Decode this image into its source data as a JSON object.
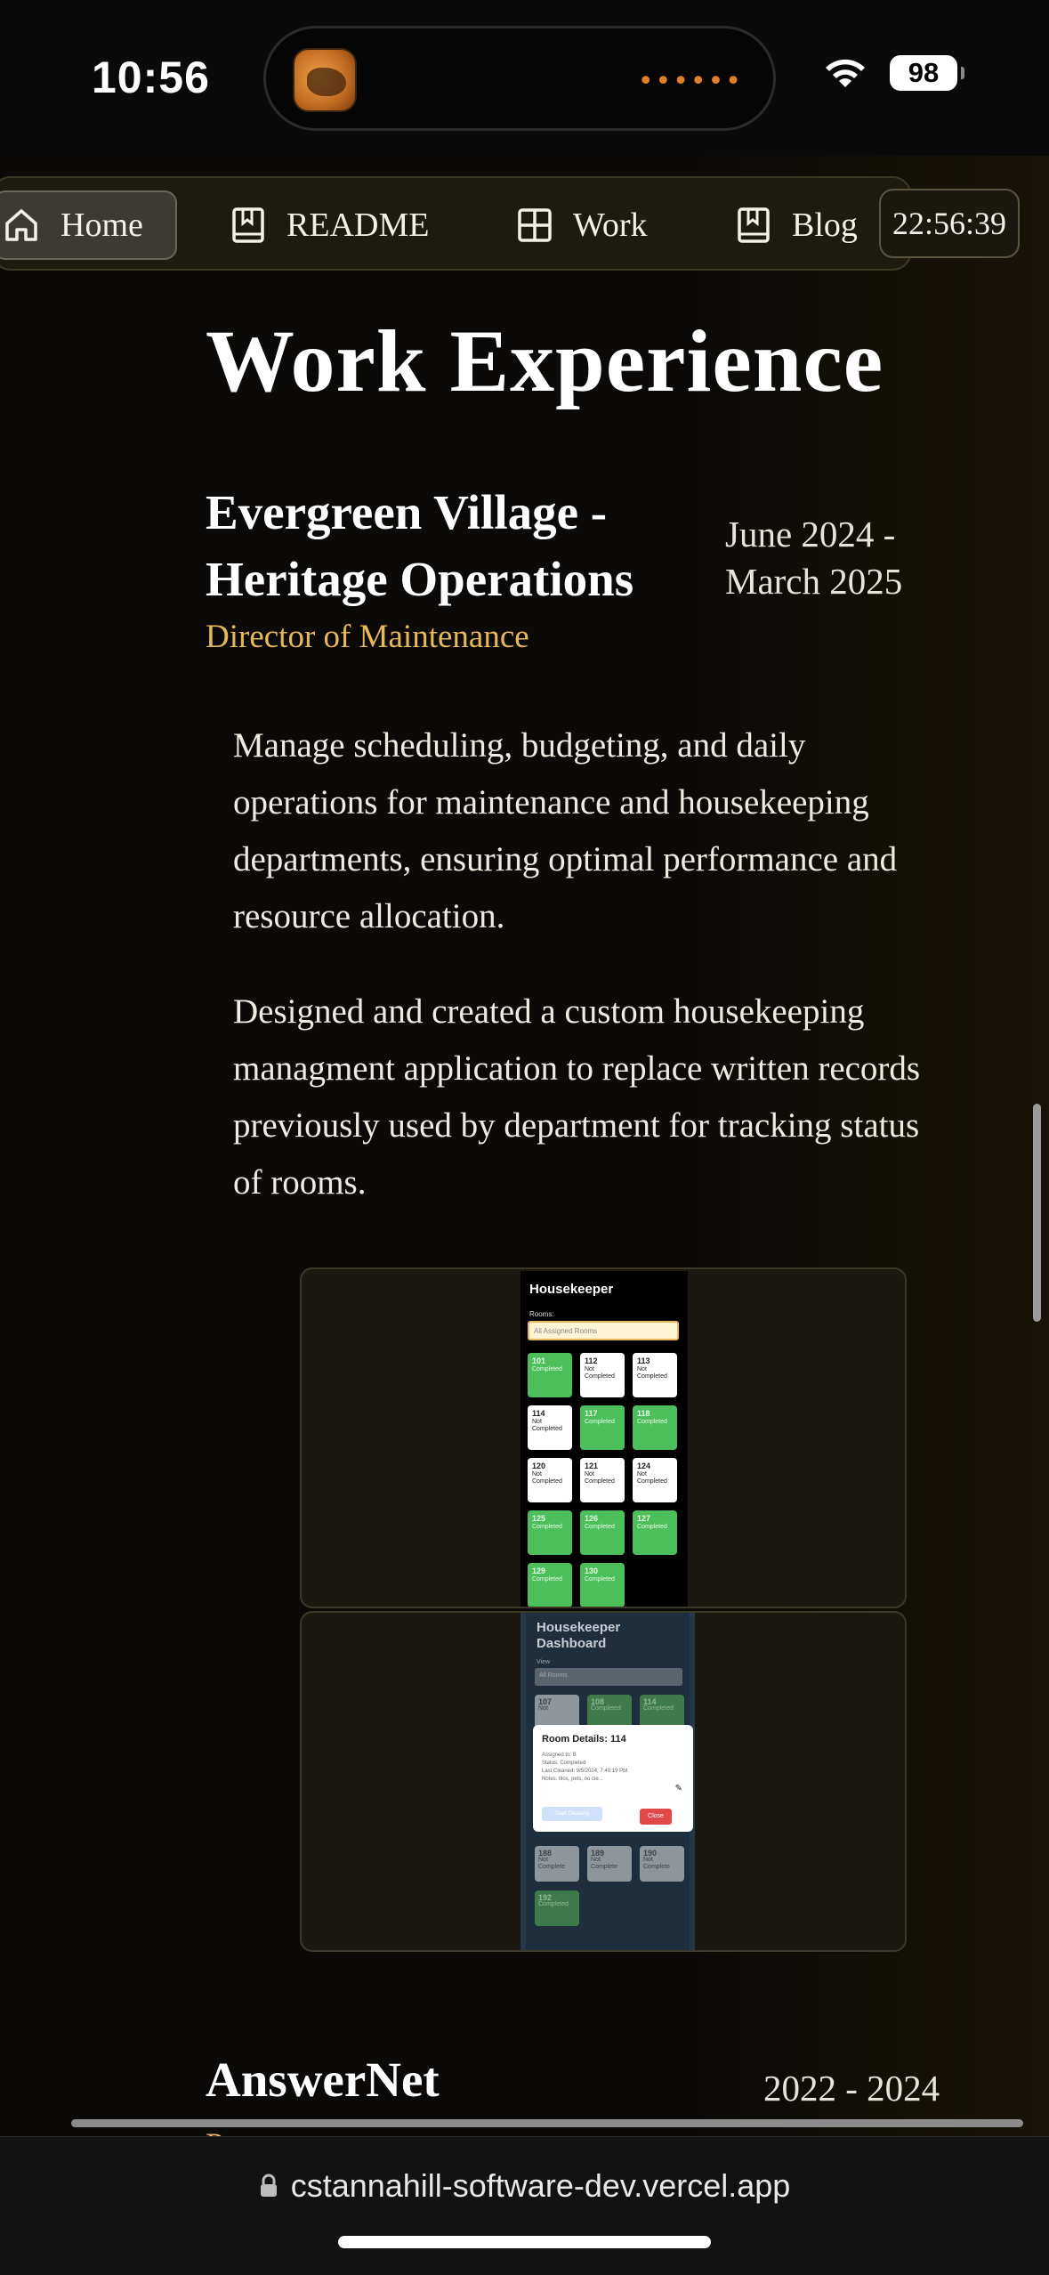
{
  "status_bar": {
    "time": "10:56",
    "battery": "98",
    "island_dots": "••••••"
  },
  "nav": {
    "items": [
      {
        "label": "Home",
        "icon": "home-icon",
        "active": true
      },
      {
        "label": "README",
        "icon": "bookmark-book-icon",
        "active": false
      },
      {
        "label": "Work",
        "icon": "grid-icon",
        "active": false
      },
      {
        "label": "Blog",
        "icon": "bookmark-book-icon",
        "active": false
      }
    ],
    "clock": "22:56:39"
  },
  "content": {
    "section_title": "Work Experience",
    "jobs": [
      {
        "company": "Evergreen Village - Heritage Operations",
        "dates": "June 2024 - March 2025",
        "role": "Director of Maintenance",
        "descriptions": [
          "Manage scheduling, budgeting, and daily operations for maintenance and housekeeping departments, ensuring optimal performance and resource allocation.",
          "Designed and created a custom housekeeping managment application to replace written records previously used by department for tracking status of rooms."
        ]
      },
      {
        "company": "AnswerNet",
        "dates": "2022 - 2024",
        "role": "P"
      }
    ]
  },
  "screenshot1": {
    "title": "Housekeeper",
    "label": "Rooms:",
    "select": "All Assigned Rooms",
    "rooms": [
      {
        "num": "101",
        "status": "Completed",
        "done": true
      },
      {
        "num": "112",
        "status": "Not Completed",
        "done": false
      },
      {
        "num": "113",
        "status": "Not Completed",
        "done": false
      },
      {
        "num": "114",
        "status": "Not Completed",
        "done": false
      },
      {
        "num": "117",
        "status": "Completed",
        "done": true
      },
      {
        "num": "118",
        "status": "Completed",
        "done": true
      },
      {
        "num": "120",
        "status": "Not Completed",
        "done": false
      },
      {
        "num": "121",
        "status": "Not Completed",
        "done": false
      },
      {
        "num": "124",
        "status": "Not Completed",
        "done": false
      },
      {
        "num": "125",
        "status": "Completed",
        "done": true
      },
      {
        "num": "126",
        "status": "Completed",
        "done": true
      },
      {
        "num": "127",
        "status": "Completed",
        "done": true
      },
      {
        "num": "129",
        "status": "Completed",
        "done": true
      },
      {
        "num": "130",
        "status": "Completed",
        "done": true
      }
    ]
  },
  "screenshot2": {
    "title": "Housekeeper Dashboard",
    "label": "View",
    "select": "All Rooms",
    "modal_title": "Room Details: 114",
    "modal_lines": [
      "Assigned to: B",
      "Status: Completed",
      "Last Cleaned: 9/5/2024, 7:40:19 PM",
      "Notes: tilos, pets, no cie..."
    ],
    "modal_btn_secondary": "Start Cleaning",
    "modal_btn_close": "Close",
    "rooms_top": [
      {
        "num": "107",
        "status": "Not",
        "color": "grey"
      },
      {
        "num": "108",
        "status": "Completed",
        "color": "green"
      },
      {
        "num": "114",
        "status": "Completed",
        "color": "green"
      }
    ],
    "rooms_bottom": [
      {
        "num": "188",
        "status": "Not Complete",
        "color": "grey"
      },
      {
        "num": "189",
        "status": "Not Complete",
        "color": "grey"
      },
      {
        "num": "190",
        "status": "Not Complete",
        "color": "grey"
      },
      {
        "num": "192",
        "status": "Completed",
        "color": "green"
      }
    ]
  },
  "url_bar": {
    "url": "cstannahill-software-dev.vercel.app"
  }
}
